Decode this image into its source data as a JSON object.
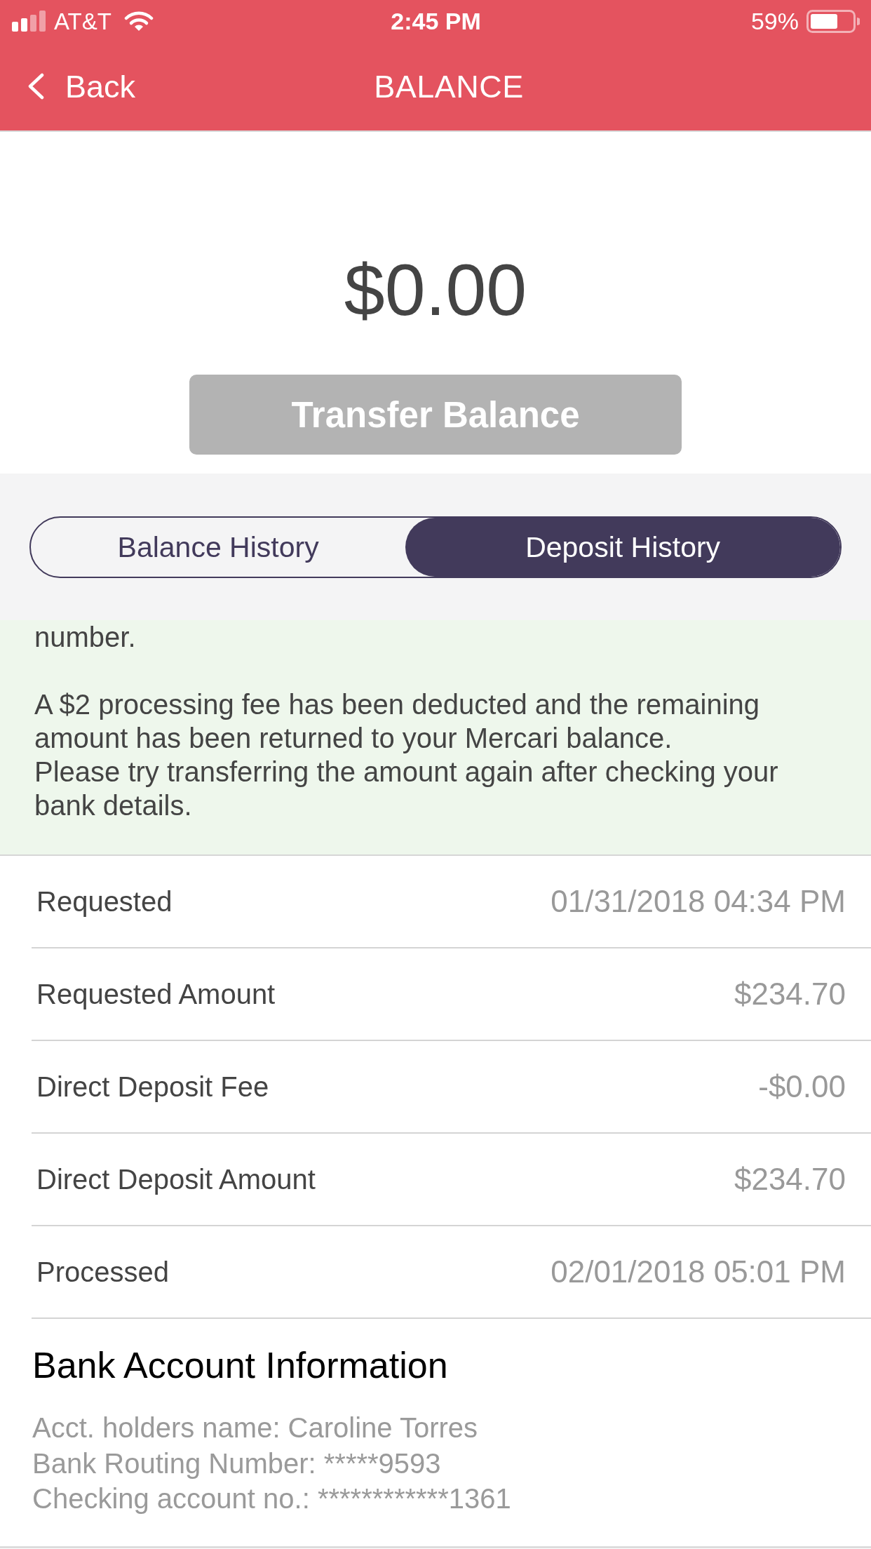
{
  "status_bar": {
    "carrier": "AT&T",
    "time": "2:45 PM",
    "battery": "59%"
  },
  "nav": {
    "back": "Back",
    "title": "BALANCE"
  },
  "balance": {
    "amount": "$0.00",
    "transfer_button": {
      "label": "Transfer Balance",
      "disabled": true
    }
  },
  "tabs": [
    {
      "label": "Balance History",
      "selected": false
    },
    {
      "label": "Deposit History",
      "selected": true
    }
  ],
  "notice": {
    "paragraphs": [
      "number.",
      "A $2 processing fee has been deducted and the remaining amount has been returned to your Mercari balance.\nPlease try transferring the amount again after checking your bank details."
    ]
  },
  "details": [
    {
      "label": "Requested",
      "value": "01/31/2018 04:34 PM"
    },
    {
      "label": "Requested Amount",
      "value": "$234.70"
    },
    {
      "label": "Direct Deposit Fee",
      "value": "-$0.00"
    },
    {
      "label": "Direct Deposit Amount",
      "value": "$234.70"
    },
    {
      "label": "Processed",
      "value": "02/01/2018 05:01 PM"
    }
  ],
  "bank_account": {
    "title": "Bank Account Information",
    "lines": [
      "Acct. holders name: Caroline Torres",
      "Bank Routing Number: *****9593",
      "Checking account no.: ************1361"
    ]
  }
}
